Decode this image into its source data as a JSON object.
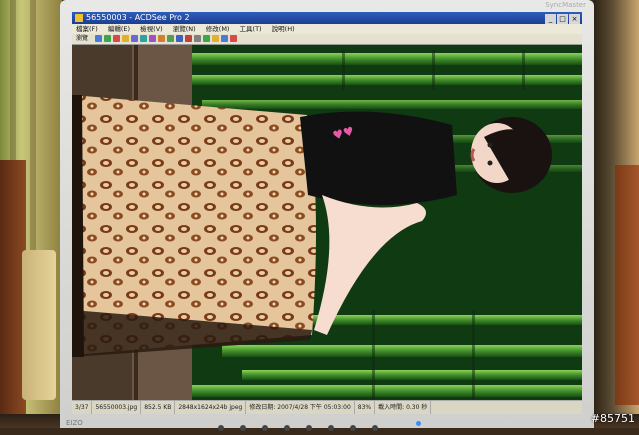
{
  "window": {
    "title": "56550003 - ACDSee Pro 2",
    "controls": [
      "_",
      "□",
      "×"
    ]
  },
  "menubar": [
    "檔案(F)",
    "編輯(E)",
    "檢視(V)",
    "瀏覽(N)",
    "修改(M)",
    "工具(T)",
    "說明(H)"
  ],
  "toolbar": {
    "label": "瀏覽",
    "button_colors": [
      "#4a7bd8",
      "#3aa84a",
      "#d84a4a",
      "#e0b030",
      "#6a6ad0",
      "#30a0a0",
      "#a050c0",
      "#d08030",
      "#50a050",
      "#4060c0",
      "#c04040",
      "#808080",
      "#3aa84a",
      "#e0b030",
      "#4a7bd8",
      "#d84a4a"
    ]
  },
  "statusbar": {
    "index": "3/37",
    "filename": "56550003.jpg",
    "filesize": "852.5 KB",
    "dimensions": "2848x1624x24b jpeg",
    "date": "修改日期: 2007/4/28 下午 05:03:00",
    "zoom": "83%",
    "load_time": "載入時間: 0.30 秒"
  },
  "monitor": {
    "brand": "SyncMaster",
    "logo": "EIZO"
  },
  "watermark": "#85751"
}
